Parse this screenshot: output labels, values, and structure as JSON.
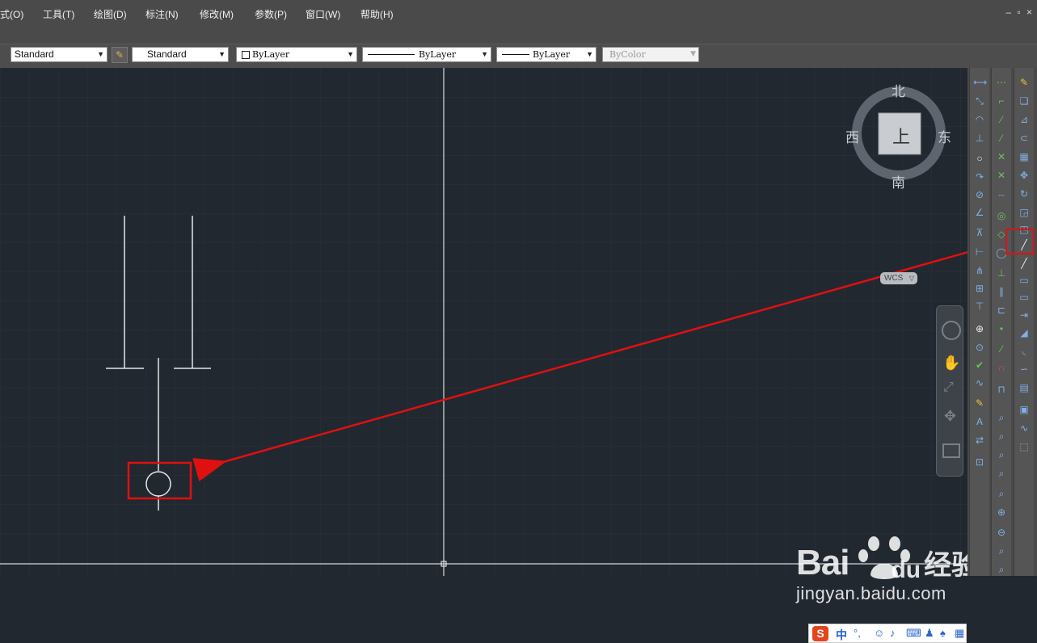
{
  "menubar": {
    "items": [
      "式(O)",
      "工具(T)",
      "绘图(D)",
      "标注(N)",
      "修改(M)",
      "参数(P)",
      "窗口(W)",
      "帮助(H)"
    ],
    "window_controls": "– ▫ ×"
  },
  "toolbar": {
    "text_style": "Standard",
    "dim_style": "Standard",
    "color": "ByLayer",
    "linetype": "ByLayer",
    "lineweight": "ByLayer",
    "plot_style": "ByColor"
  },
  "viewcube": {
    "north": "北",
    "south": "南",
    "east": "东",
    "west": "西",
    "face": "上",
    "wcs": "WCS"
  },
  "ime": {
    "zh": "中",
    "punct": "°,"
  },
  "watermark": {
    "brand": "Bai",
    "brand2": "du",
    "cn": "经验",
    "url": "jingyan.baidu.com"
  },
  "colors": {
    "canvas": "#212830",
    "grid": "#2d3540",
    "highlight": "#e01010",
    "geometry": "#ffffff"
  }
}
